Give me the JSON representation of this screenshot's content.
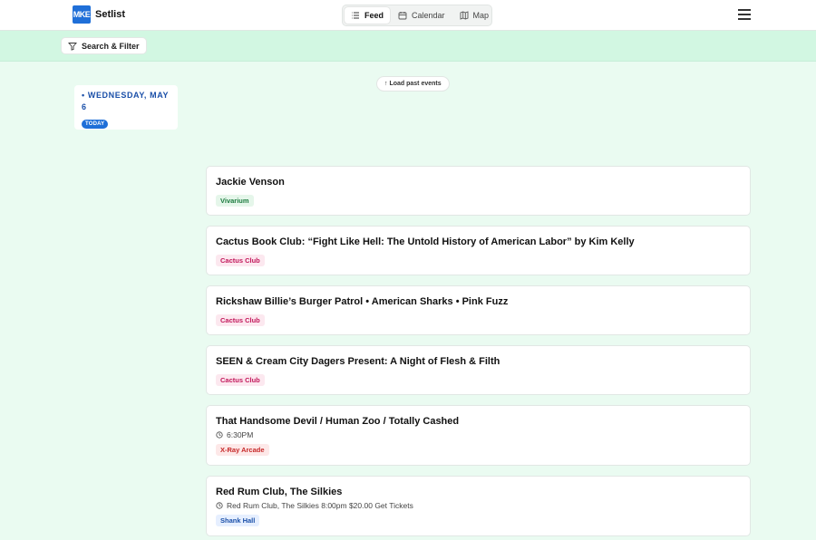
{
  "header": {
    "logo_badge": "MKE",
    "app_name": "Setlist",
    "tabs": [
      {
        "label": "Feed",
        "icon": "list-icon",
        "active": true
      },
      {
        "label": "Calendar",
        "icon": "calendar-icon",
        "active": false
      },
      {
        "label": "Map",
        "icon": "map-icon",
        "active": false
      }
    ]
  },
  "filter": {
    "label": "Search & Filter"
  },
  "load_past": "↑ Load past events",
  "day": {
    "label": "• WEDNESDAY, MAY 6",
    "badge": "TODAY"
  },
  "events": [
    {
      "title": "Jackie Venson",
      "venue": "Vivarium",
      "venue_color": "#1b7a3e",
      "venue_bg": "#e5f6ea"
    },
    {
      "title": "Cactus Book Club: “Fight Like Hell: The Untold History of American Labor” by Kim Kelly",
      "venue": "Cactus Club",
      "venue_color": "#c2185b",
      "venue_bg": "#fce8ef"
    },
    {
      "title": "Rickshaw Billie’s Burger Patrol • American Sharks • Pink Fuzz",
      "venue": "Cactus Club",
      "venue_color": "#c2185b",
      "venue_bg": "#fce8ef"
    },
    {
      "title": "SEEN & Cream City Dagers Present: A Night of Flesh & Filth",
      "venue": "Cactus Club",
      "venue_color": "#c2185b",
      "venue_bg": "#fce8ef"
    },
    {
      "title": "That Handsome Devil / Human Zoo / Totally Cashed",
      "meta": "6:30PM",
      "venue": "X-Ray Arcade",
      "venue_color": "#c62828",
      "venue_bg": "#fde8e8"
    },
    {
      "title": "Red Rum Club, The Silkies",
      "meta": "Red Rum Club, The Silkies 8:00pm $20.00 Get Tickets",
      "venue": "Shank Hall",
      "venue_color": "#1a4fa8",
      "venue_bg": "#e6efff"
    }
  ]
}
